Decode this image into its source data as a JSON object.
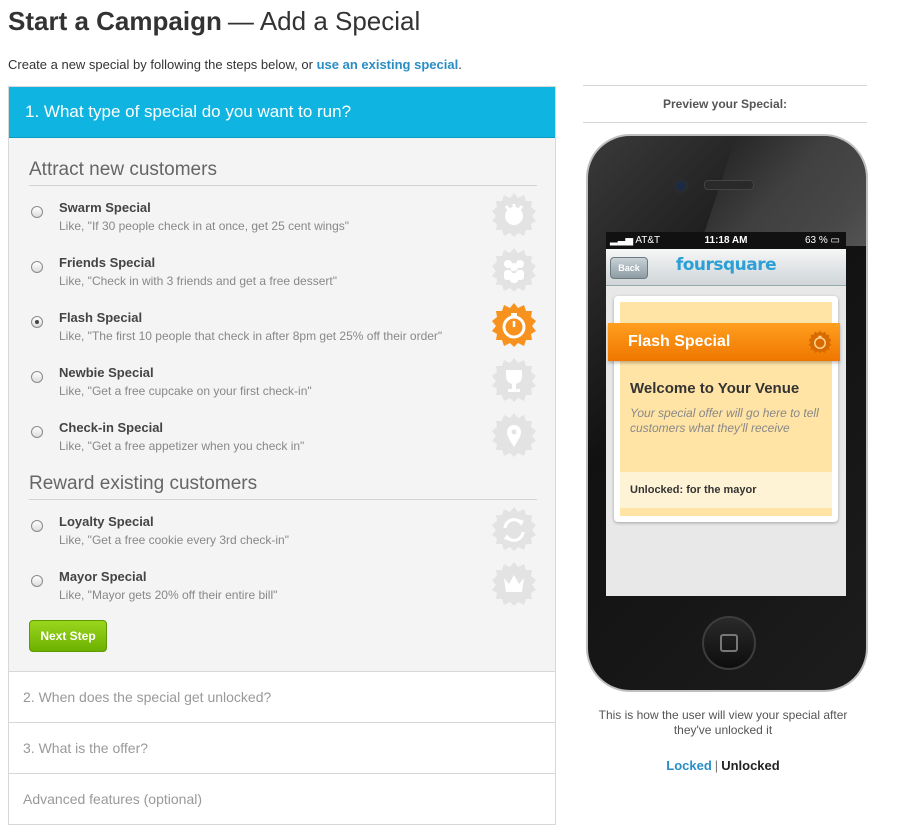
{
  "header": {
    "title_bold": "Start a Campaign",
    "separator": "—",
    "title_rest": "Add a Special",
    "intro_text": "Create a new special by following the steps below, or",
    "intro_link": "use an existing special",
    "intro_end": "."
  },
  "step1": {
    "heading": "1. What type of special do you want to run?",
    "groups": [
      {
        "title": "Attract new customers",
        "options": [
          {
            "label": "Swarm Special",
            "desc": "Like, \"If 30 people check in at once, get 25 cent wings\"",
            "icon": "swarm-icon",
            "selected": false
          },
          {
            "label": "Friends Special",
            "desc": "Like, \"Check in with 3 friends and get a free dessert\"",
            "icon": "friends-icon",
            "selected": false
          },
          {
            "label": "Flash Special",
            "desc": "Like, \"The first 10 people that check in after 8pm get 25% off their order\"",
            "icon": "stopwatch-icon",
            "selected": true
          },
          {
            "label": "Newbie Special",
            "desc": "Like, \"Get a free cupcake on your first check-in\"",
            "icon": "trophy-icon",
            "selected": false
          },
          {
            "label": "Check-in Special",
            "desc": "Like, \"Get a free appetizer when you check in\"",
            "icon": "map-pin-icon",
            "selected": false
          }
        ]
      },
      {
        "title": "Reward existing customers",
        "options": [
          {
            "label": "Loyalty Special",
            "desc": "Like, \"Get a free cookie every 3rd check-in\"",
            "icon": "loop-arrows-icon",
            "selected": false
          },
          {
            "label": "Mayor Special",
            "desc": "Like, \"Mayor gets 20% off their entire bill\"",
            "icon": "crown-icon",
            "selected": false
          }
        ]
      }
    ],
    "next_label": "Next Step"
  },
  "collapsed_steps": [
    "2. When does the special get unlocked?",
    "3. What is the offer?",
    "Advanced features (optional)"
  ],
  "preview": {
    "heading": "Preview your Special:",
    "status": {
      "carrier": "AT&T",
      "time": "11:18 AM",
      "battery": "63 %"
    },
    "back_label": "Back",
    "app_logo": "foursquare",
    "ribbon_title": "Flash Special",
    "venue": "Welcome to Your Venue",
    "offer": "Your special offer will go here to tell customers what they'll receive",
    "unlocked": "Unlocked: for the mayor",
    "caption": "This is how the user will view your special after they've unlocked it",
    "toggle_locked": "Locked",
    "toggle_sep": "|",
    "toggle_unlocked": "Unlocked"
  },
  "colors": {
    "header_blue": "#0fb5e0",
    "link_blue": "#2a8ec6",
    "badge_grey": "#e3e3e3",
    "badge_orange": "#f7921e",
    "button_green": "#7fc40c"
  }
}
